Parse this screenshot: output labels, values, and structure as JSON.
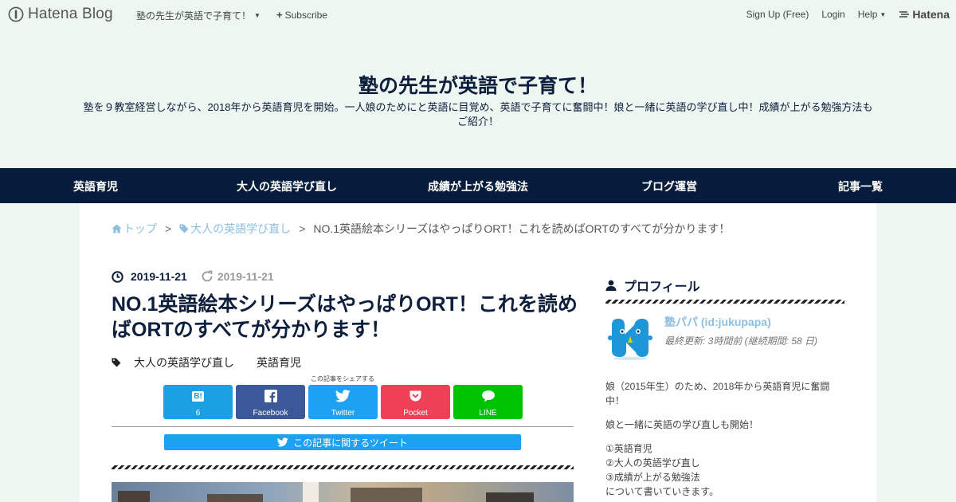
{
  "topbar": {
    "brand": "Hatena Blog",
    "blog_menu": "塾の先生が英語で子育て！",
    "subscribe": "Subscribe",
    "signup": "Sign Up (Free)",
    "login": "Login",
    "help": "Help",
    "hatena": "Hatena"
  },
  "header": {
    "title": "塾の先生が英語で子育て！",
    "description": "塾を９教室経営しながら、2018年から英語育児を開始。一人娘のためにと英語に目覚め、英語で子育てに奮闘中！娘と一緒に英語の学び直し中！成績が上がる勉強方法もご紹介！"
  },
  "nav": {
    "items": [
      "英語育児",
      "大人の英語学び直し",
      "成績が上がる勉強法",
      "ブログ運営",
      "記事一覧"
    ]
  },
  "breadcrumb": {
    "top": "トップ",
    "category": "大人の英語学び直し",
    "current": "NO.1英語絵本シリーズはやっぱりORT！これを読めばORTのすべてが分かります！",
    "separator": ">"
  },
  "entry": {
    "published": "2019-11-21",
    "updated": "2019-11-21",
    "title": "NO.1英語絵本シリーズはやっぱりORT！これを読めばORTのすべてが分かります！",
    "categories": [
      "大人の英語学び直し",
      "英語育児"
    ],
    "share_caption": "この記事をシェアする",
    "share_buttons": [
      {
        "icon": "hatebu-icon",
        "label": "6",
        "color": "#1ba0e1"
      },
      {
        "icon": "facebook-icon",
        "label": "Facebook",
        "color": "#3b5998"
      },
      {
        "icon": "twitter-icon",
        "label": "Twitter",
        "color": "#1da1f2"
      },
      {
        "icon": "pocket-icon",
        "label": "Pocket",
        "color": "#ee4056"
      },
      {
        "icon": "line-icon",
        "label": "LINE",
        "color": "#00c300"
      }
    ],
    "tweet_bar": "この記事に関するツイート"
  },
  "sidebar": {
    "profile_title": "プロフィール",
    "name": "塾パパ (id:jukupapa)",
    "last_update": "最終更新: 3時間前 (継続期間: 58 日)",
    "bio": [
      "娘（2015年生）のため、2018年から英語育児に奮闘中！",
      "娘と一緒に英語の学び直しも開始！"
    ],
    "topics": [
      "①英語育児",
      "②大人の英語学び直し",
      "③成績が上がる勉強法",
      "について書いていきます。"
    ]
  },
  "colors": {
    "page_bg": "#eef6f1",
    "nav_bg": "#061c3d",
    "title_color": "#0e1f3d",
    "link_color": "#8cbfe0"
  }
}
